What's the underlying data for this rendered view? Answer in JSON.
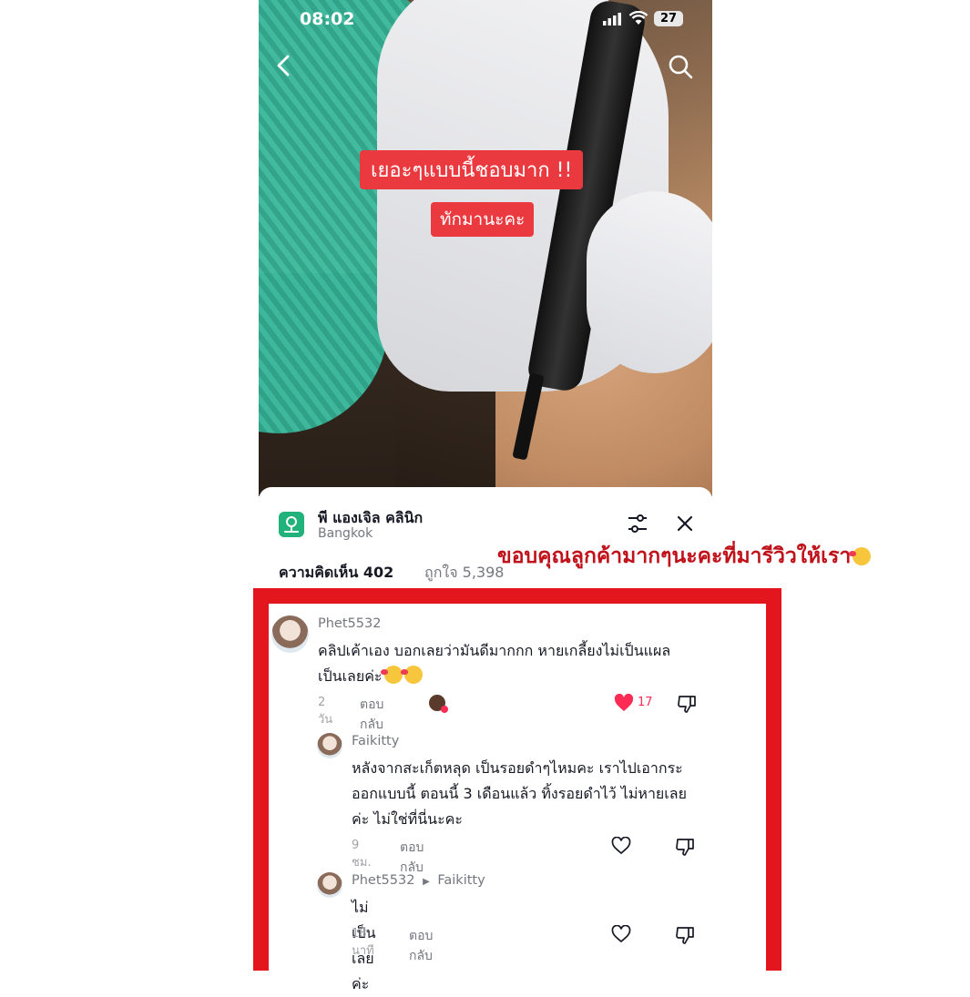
{
  "status_bar": {
    "time": "08:02",
    "battery": "27"
  },
  "video": {
    "caption_line1": "เยอะๆแบบนี้ชอบมาก !!",
    "caption_line2": "ทักมานะคะ"
  },
  "location": {
    "name": "พี แองเจิล คลินิก",
    "city": "Bangkok"
  },
  "tabs": {
    "comments": "ความคิดเห็น 402",
    "likes": "ถูกใจ 5,398"
  },
  "annotation": {
    "thanks": "ขอบคุณลูกค้ามากๆนะคะที่มารีวิวให้เรา"
  },
  "comments": [
    {
      "user": "Phet5532",
      "line1": "คลิปเค้าเอง บอกเลยว่ามันดีมากกก หายเกลี้ยงไม่เป็นแผล",
      "line2": "เป็นเลยค่ะ",
      "time": "2 วัน",
      "reply": "ตอบกลับ",
      "likes": "17"
    },
    {
      "user": "Faikitty",
      "line1": "หลังจากสะเก็ตหลุด เป็นรอยดำๆไหมคะ เราไปเอากระ",
      "line2": "ออกแบบนี้ ตอนนี้ 3 เดือนแล้ว ทิ้งรอยดำไว้ ไม่หายเลย",
      "line3": "ค่ะ ไม่ใช่ที่นี่นะคะ",
      "time": "9 ชม.",
      "reply": "ตอบกลับ"
    },
    {
      "user": "Phet5532",
      "reply_to": "Faikitty",
      "line1": "ไม่เป็นเลยค่ะ",
      "time": "18 นาที",
      "reply": "ตอบกลับ"
    }
  ],
  "colors": {
    "accent": "#fe2c55",
    "annotation": "#c0121a",
    "frame": "#e3151d"
  }
}
